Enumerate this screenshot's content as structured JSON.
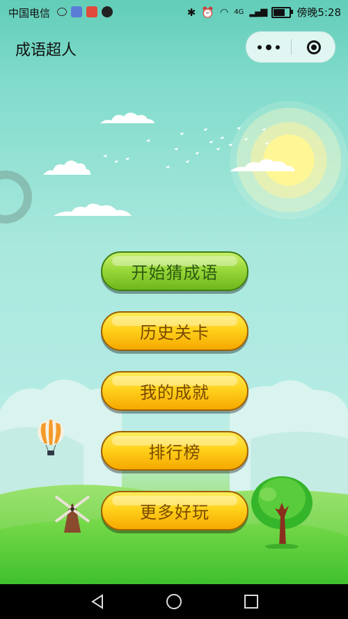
{
  "status_bar": {
    "carrier": "中国电信",
    "time": "傍晚5:28",
    "network": "4G"
  },
  "title_bar": {
    "title": "成语超人"
  },
  "menu": {
    "items": [
      {
        "label": "开始猜成语",
        "style": "green"
      },
      {
        "label": "历史关卡",
        "style": "yellow"
      },
      {
        "label": "我的成就",
        "style": "yellow"
      },
      {
        "label": "排行榜",
        "style": "yellow"
      },
      {
        "label": "更多好玩",
        "style": "yellow"
      }
    ]
  },
  "icons": {
    "capsule_menu": "more-dots-icon",
    "capsule_close": "mini-program-close-icon",
    "nav_back": "triangle-back-icon",
    "nav_home": "circle-home-icon",
    "nav_recent": "square-recent-icon"
  },
  "colors": {
    "sky_top": "#62cdb8",
    "green_button": "#9ad83a",
    "yellow_button": "#ffd21c",
    "grass": "#6fd84f"
  }
}
